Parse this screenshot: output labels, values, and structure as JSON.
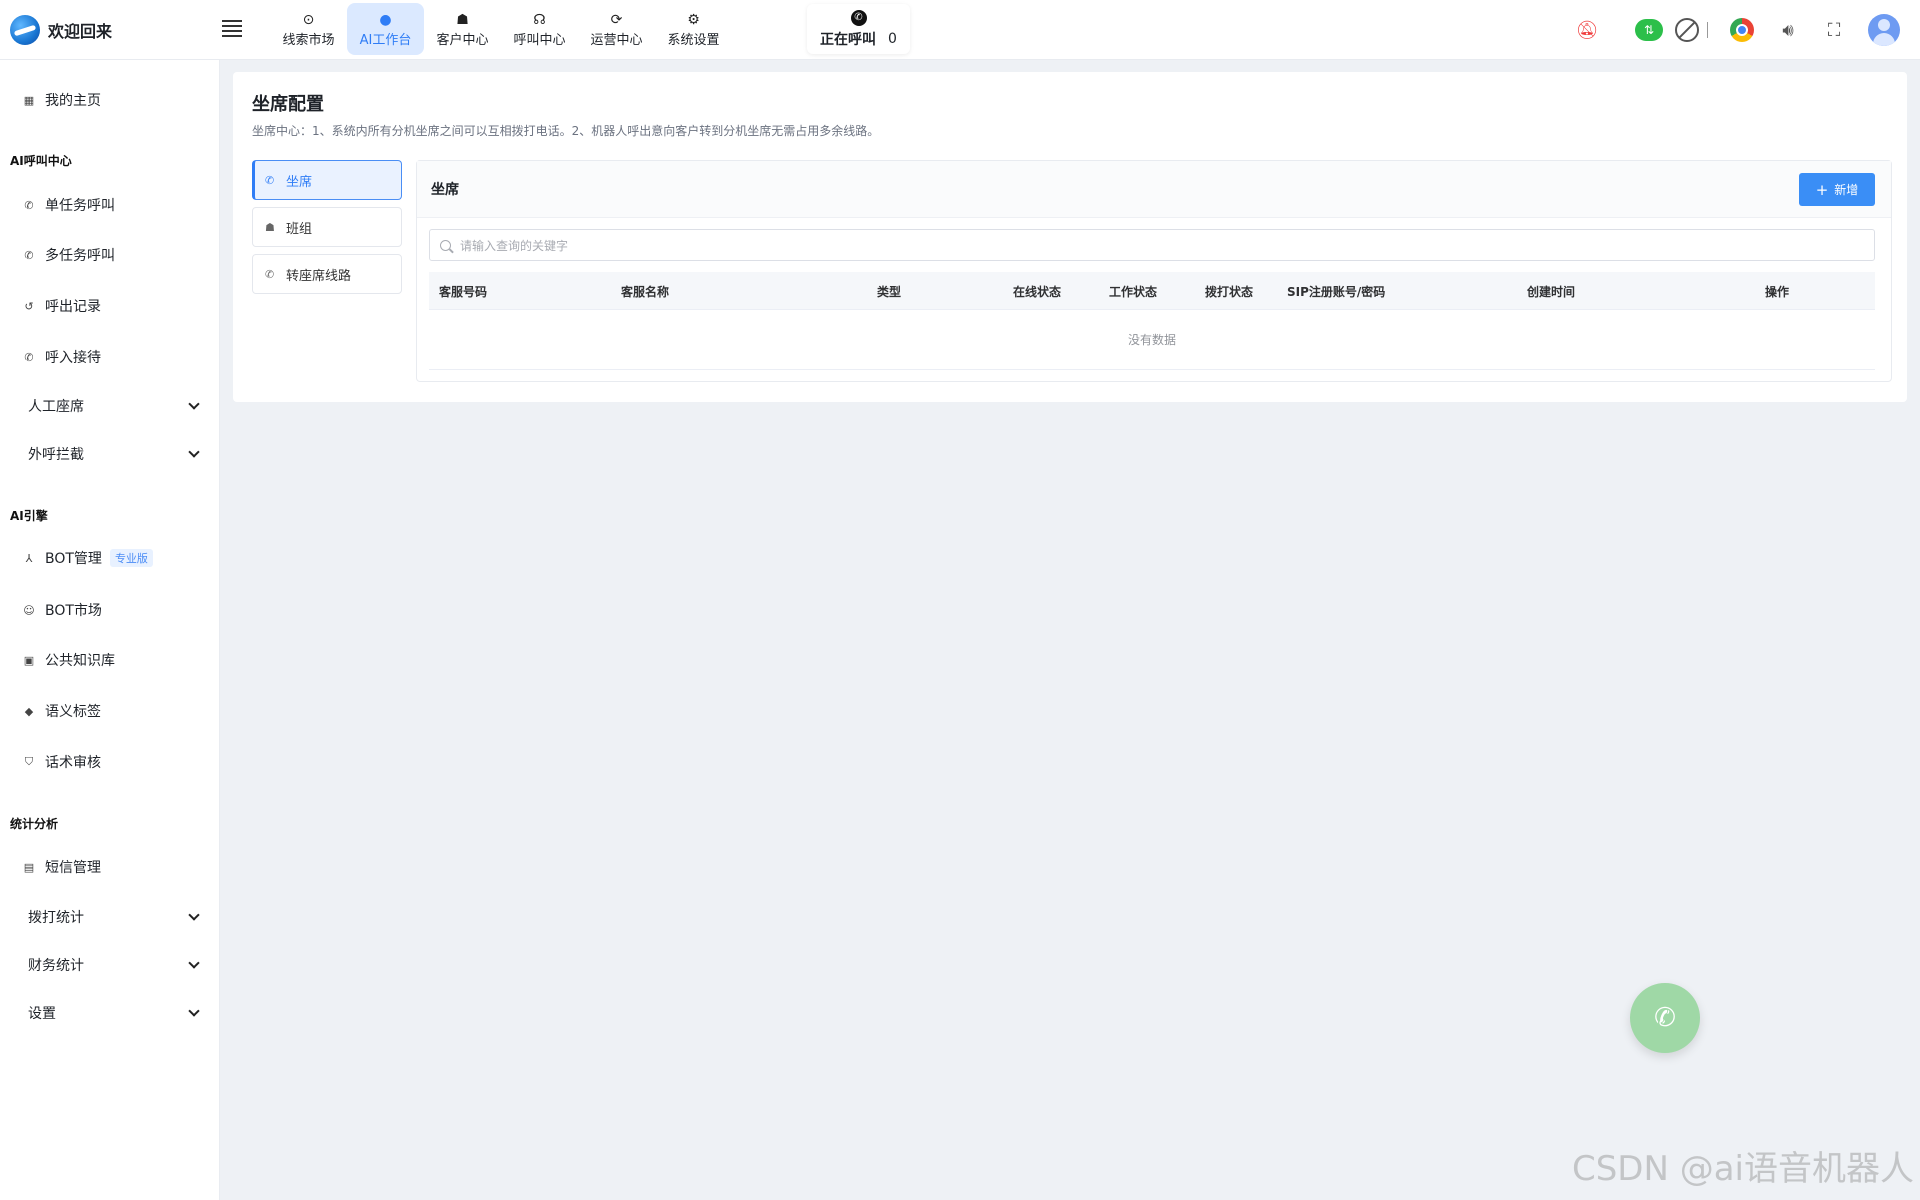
{
  "brand": {
    "title": "欢迎回来"
  },
  "nav": [
    {
      "label": "线索市场",
      "icon": "clue-icon"
    },
    {
      "label": "AI工作台",
      "icon": "ai-icon",
      "active": true
    },
    {
      "label": "客户中心",
      "icon": "customers-icon"
    },
    {
      "label": "呼叫中心",
      "icon": "headset-icon"
    },
    {
      "label": "运营中心",
      "icon": "operations-icon"
    },
    {
      "label": "系统设置",
      "icon": "gear-icon"
    }
  ],
  "calling": {
    "label": "正在呼叫",
    "count": "0"
  },
  "sidebar": {
    "home": "我的主页",
    "group_ai_call": "AI呼叫中心",
    "single_task": "单任务呼叫",
    "multi_task": "多任务呼叫",
    "outbound_records": "呼出记录",
    "inbound_reception": "呼入接待",
    "manual_seats": "人工座席",
    "outbound_intercept": "外呼拦截",
    "group_ai_engine": "AI引擎",
    "bot_manage": "BOT管理",
    "bot_badge": "专业版",
    "bot_market": "BOT市场",
    "public_kb": "公共知识库",
    "semantic_tags": "语义标签",
    "script_review": "话术审核",
    "group_stats": "统计分析",
    "sms_manage": "短信管理",
    "dial_stats": "拨打统计",
    "finance_stats": "财务统计",
    "settings": "设置"
  },
  "page": {
    "title": "坐席配置",
    "description": "坐席中心：1、系统内所有分机坐席之间可以互相拨打电话。2、机器人呼出意向客户转到分机坐席无需占用多余线路。",
    "tabs": [
      "坐席",
      "班组",
      "转座席线路"
    ]
  },
  "panel": {
    "title": "坐席",
    "add_label": "新增",
    "search_placeholder": "请输入查询的关键字",
    "columns": [
      "客服号码",
      "客服名称",
      "类型",
      "在线状态",
      "工作状态",
      "拨打状态",
      "SIP注册账号/密码",
      "创建时间",
      "操作"
    ],
    "empty_text": "没有数据"
  },
  "watermark": "CSDN @ai语音机器人",
  "colors": {
    "accent": "#3a8ef6",
    "active_nav_bg": "#dbe9ff",
    "fab": "#9fd8a6",
    "bell": "#f03b3b",
    "cloud": "#2cbf4a"
  }
}
